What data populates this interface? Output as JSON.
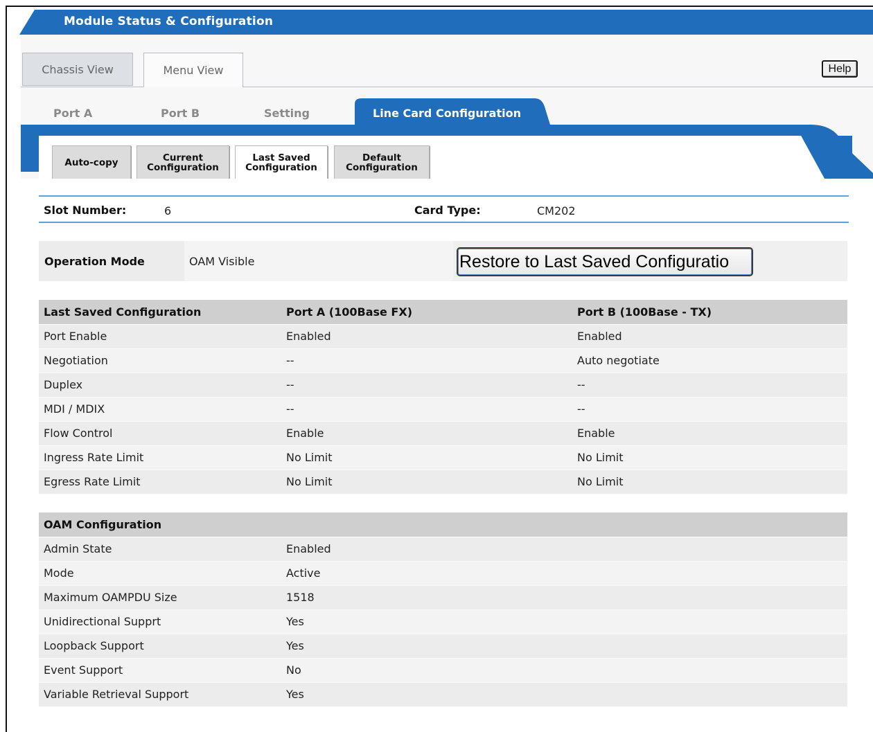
{
  "header": {
    "title": "Module Status & Configuration"
  },
  "view_tabs": {
    "chassis": "Chassis View",
    "menu": "Menu View"
  },
  "help_label": "Help",
  "port_tabs": [
    "Port A",
    "Port B",
    "Setting",
    "Line Card Configuration"
  ],
  "sub_tabs": [
    {
      "line1": "Auto-copy",
      "line2": ""
    },
    {
      "line1": "Current",
      "line2": "Configuration"
    },
    {
      "line1": "Last Saved",
      "line2": "Configuration"
    },
    {
      "line1": "Default",
      "line2": "Configuration"
    }
  ],
  "slot": {
    "label": "Slot Number:",
    "value": "6"
  },
  "card": {
    "label": "Card Type:",
    "value": "CM202"
  },
  "operation": {
    "label": "Operation Mode",
    "value": "OAM Visible",
    "button": "Restore to Last Saved Configuratio"
  },
  "last_saved": {
    "headers": [
      "Last Saved Configuration",
      "Port A (100Base FX)",
      "Port B (100Base - TX)"
    ],
    "rows": [
      [
        "Port Enable",
        "Enabled",
        "Enabled"
      ],
      [
        "Negotiation",
        "--",
        "Auto negotiate"
      ],
      [
        "Duplex",
        "--",
        "--"
      ],
      [
        "MDI / MDIX",
        "--",
        "--"
      ],
      [
        "Flow Control",
        "Enable",
        "Enable"
      ],
      [
        "Ingress Rate Limit",
        "No Limit",
        "No Limit"
      ],
      [
        "Egress Rate Limit",
        "No Limit",
        "No Limit"
      ]
    ]
  },
  "oam": {
    "header": "OAM Configuration",
    "rows": [
      [
        "Admin State",
        "Enabled"
      ],
      [
        "Mode",
        "Active"
      ],
      [
        "Maximum OAMPDU Size",
        "1518"
      ],
      [
        "Unidirectional Supprt",
        "Yes"
      ],
      [
        "Loopback Support",
        "Yes"
      ],
      [
        "Event Support",
        "No"
      ],
      [
        "Variable Retrieval Support",
        "Yes"
      ]
    ]
  },
  "colors": {
    "brand_blue": "#1f6dbb",
    "accent_line": "#5aa2d6"
  }
}
